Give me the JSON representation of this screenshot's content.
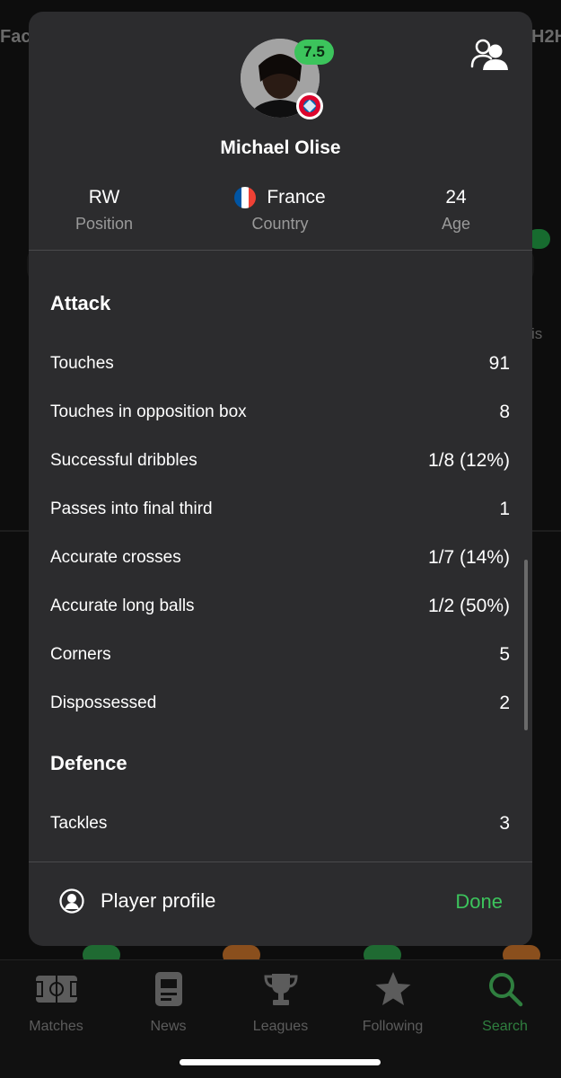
{
  "background": {
    "left_tab": "Fac",
    "right_tab": "H2H",
    "side_text": "is"
  },
  "player": {
    "name": "Michael Olise",
    "rating": "7.5",
    "position_value": "RW",
    "position_label": "Position",
    "country_value": "France",
    "country_label": "Country",
    "age_value": "24",
    "age_label": "Age"
  },
  "sections": {
    "attack": {
      "title": "Attack",
      "rows": [
        {
          "label": "Touches",
          "value": "91"
        },
        {
          "label": "Touches in opposition box",
          "value": "8"
        },
        {
          "label": "Successful dribbles",
          "value": "1/8 (12%)"
        },
        {
          "label": "Passes into final third",
          "value": "1"
        },
        {
          "label": "Accurate crosses",
          "value": "1/7 (14%)"
        },
        {
          "label": "Accurate long balls",
          "value": "1/2 (50%)"
        },
        {
          "label": "Corners",
          "value": "5"
        },
        {
          "label": "Dispossessed",
          "value": "2"
        }
      ]
    },
    "defence": {
      "title": "Defence",
      "rows": [
        {
          "label": "Tackles",
          "value": "3"
        }
      ]
    }
  },
  "footer": {
    "profile_label": "Player profile",
    "done_label": "Done"
  },
  "tabbar": {
    "items": [
      {
        "label": "Matches",
        "icon": "pitch-icon"
      },
      {
        "label": "News",
        "icon": "news-icon"
      },
      {
        "label": "Leagues",
        "icon": "trophy-icon"
      },
      {
        "label": "Following",
        "icon": "star-icon"
      },
      {
        "label": "Search",
        "icon": "search-icon"
      }
    ],
    "active": "Search"
  },
  "colors": {
    "accent_green": "#3cc45c",
    "sheet_bg": "#2c2c2e",
    "muted_text": "#9a9a9a"
  }
}
